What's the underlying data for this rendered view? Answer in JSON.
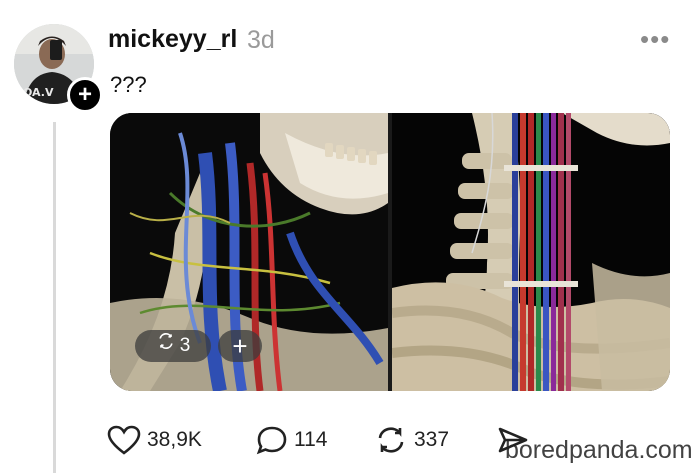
{
  "post": {
    "username": "mickeyy_rl",
    "timestamp": "3d",
    "more_icon": "more-dots-icon",
    "caption": "???",
    "avatar_shirt_text": "OA.V",
    "follow_label": "+",
    "media": {
      "repost_count": "3",
      "add_label": "+"
    },
    "actions": {
      "likes": "38,9K",
      "replies": "114",
      "reposts": "337"
    }
  },
  "watermark": "boredpanda.com"
}
